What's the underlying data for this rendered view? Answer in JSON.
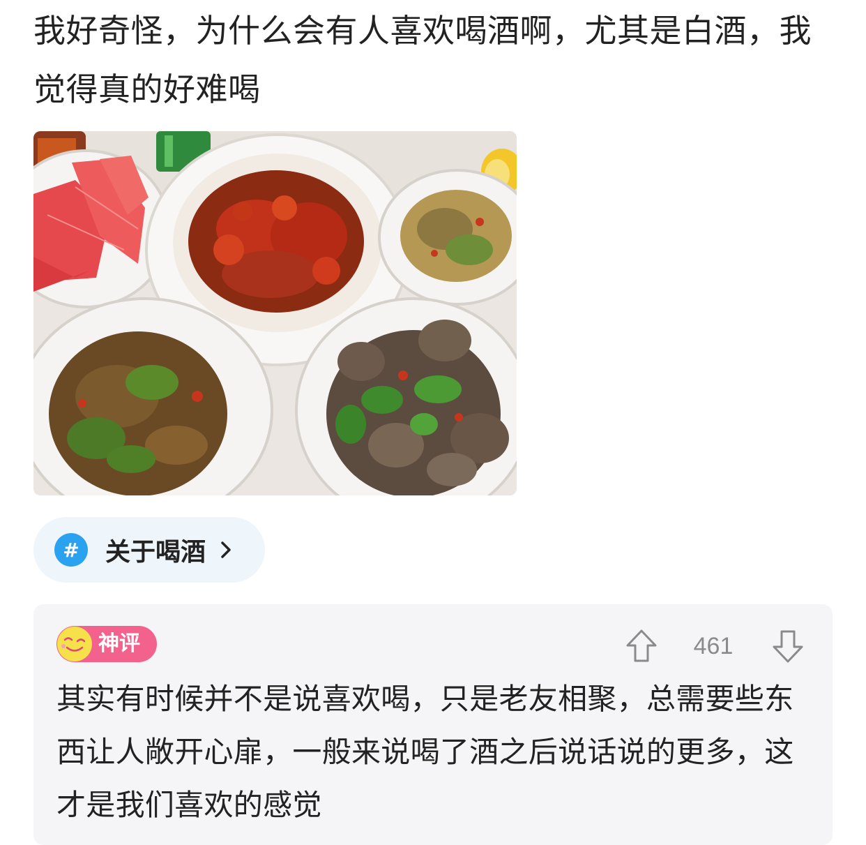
{
  "post": {
    "text": "我好奇怪，为什么会有人喜欢喝酒啊，尤其是白酒，我觉得真的好难喝"
  },
  "topic": {
    "hash_symbol": "#",
    "label": "关于喝酒",
    "icon_color": "#2aa2f0"
  },
  "comment": {
    "badge_label": "神评",
    "badge_color": "#f2628c",
    "badge_icon": "smiley-face-icon",
    "vote_count": "461",
    "up_icon": "arrow-up-icon",
    "down_icon": "arrow-down-icon",
    "text": "其实有时候并不是说喜欢喝，只是老友相聚，总需要些东西让人敞开心扉，一般来说喝了酒之后说话说的更多，这才是我们喜欢的感觉"
  }
}
